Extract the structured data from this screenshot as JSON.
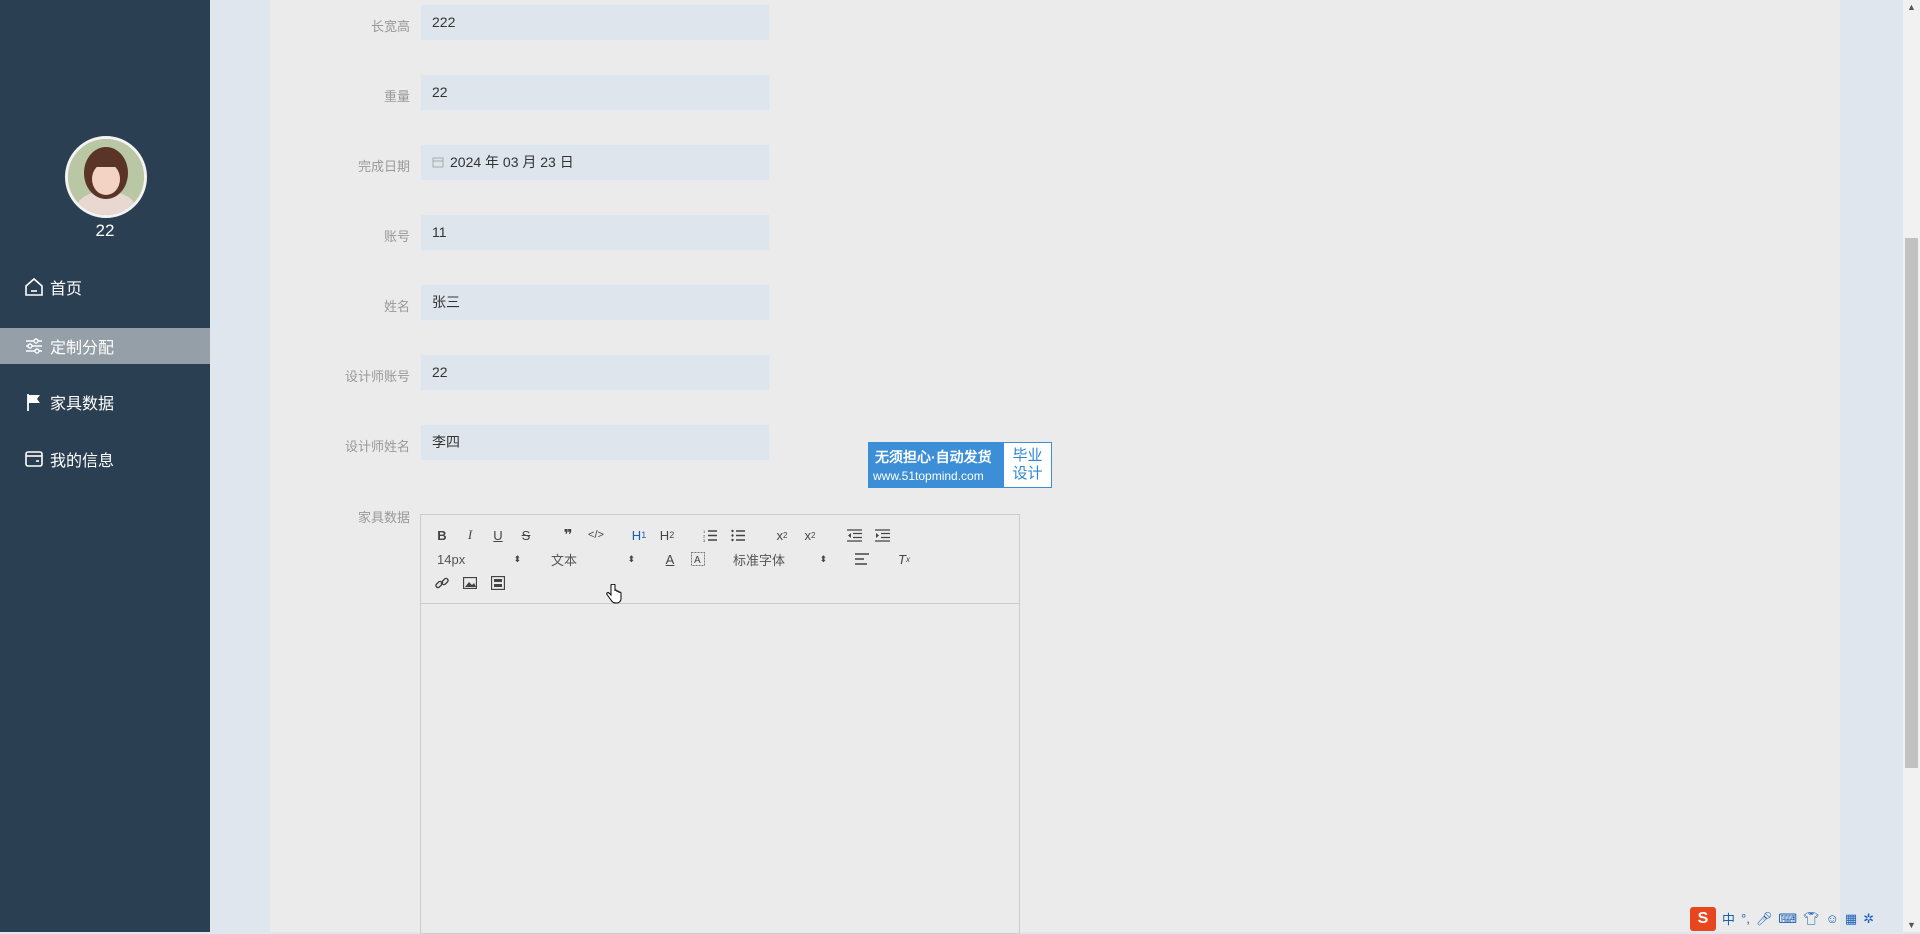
{
  "sidebar": {
    "username": "22",
    "items": [
      {
        "label": "首页",
        "icon": "home-icon"
      },
      {
        "label": "定制分配",
        "icon": "sliders-icon",
        "active": true
      },
      {
        "label": "家具数据",
        "icon": "flag-icon"
      },
      {
        "label": "我的信息",
        "icon": "wallet-icon"
      }
    ]
  },
  "form": {
    "dimensions": {
      "label": "长宽高",
      "value": "222"
    },
    "weight": {
      "label": "重量",
      "value": "22"
    },
    "completion_date": {
      "label": "完成日期",
      "value": "2024 年 03 月 23 日"
    },
    "account": {
      "label": "账号",
      "value": "11"
    },
    "name": {
      "label": "姓名",
      "value": "张三"
    },
    "designer_account": {
      "label": "设计师账号",
      "value": "22"
    },
    "designer_name": {
      "label": "设计师姓名",
      "value": "李四"
    },
    "furniture_data": {
      "label": "家具数据"
    }
  },
  "editor": {
    "size_select": "14px",
    "header_select": "文本",
    "font_select": "标准字体",
    "buttons": [
      "bold",
      "italic",
      "underline",
      "strike",
      "blockquote",
      "code-block",
      "h1",
      "h2",
      "ordered-list",
      "bullet-list",
      "subscript",
      "superscript",
      "outdent",
      "indent",
      "font-color",
      "background-color",
      "align",
      "clean",
      "link",
      "image",
      "video"
    ]
  },
  "ad": {
    "line1": "无须担心·自动发货",
    "line2": "www.51topmind.com",
    "right_line1": "毕业",
    "right_line2": "设计"
  },
  "ime": {
    "lang": "中",
    "punct": "°,"
  },
  "colors": {
    "sidebar_bg": "#2b3f52",
    "active_item_bg": "#959fa7",
    "panel_bg": "#ebebeb",
    "field_bg": "#dfe5ec",
    "ad_blue": "#3c8fd6"
  }
}
